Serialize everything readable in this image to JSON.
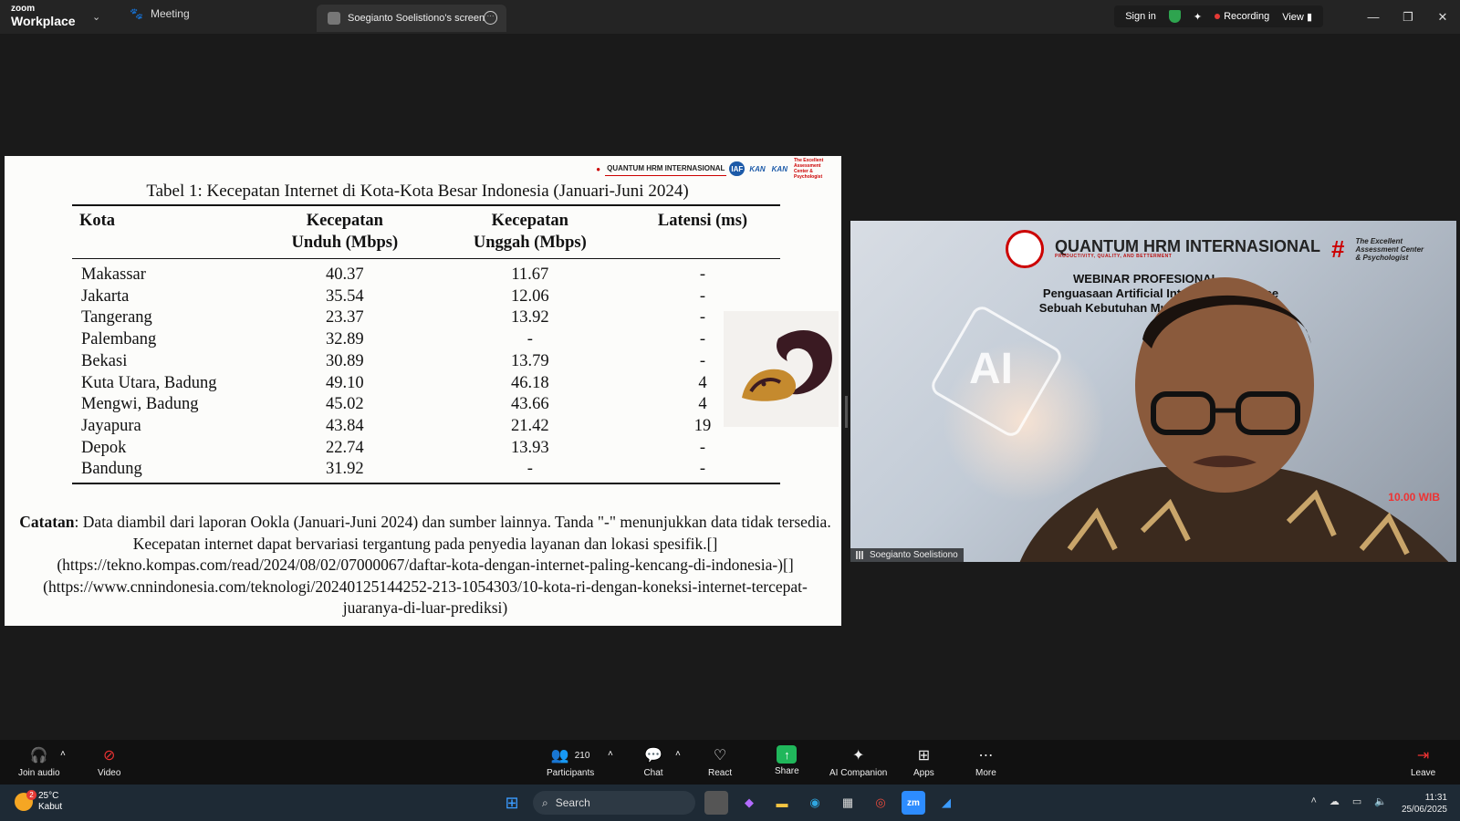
{
  "app": {
    "brand_top": "zoom",
    "brand_bottom": "Workplace"
  },
  "tabs": {
    "meeting": "Meeting",
    "screen": "Soegianto Soelistiono's screen"
  },
  "topright": {
    "sign_in": "Sign in",
    "recording": "Recording",
    "view": "View"
  },
  "shared": {
    "logos": [
      "QUANTUM HRM INTERNASIONAL",
      "IAF",
      "KAN",
      "KAN",
      "The Excellent Assessment Center & Psychologist"
    ],
    "caption": "Tabel 1: Kecepatan Internet di Kota-Kota Besar Indonesia (Januari-Juni 2024)",
    "headers": {
      "kota": "Kota",
      "unduh_1": "Kecepatan",
      "unduh_2": "Unduh (Mbps)",
      "unggah_1": "Kecepatan",
      "unggah_2": "Unggah (Mbps)",
      "latensi": "Latensi (ms)"
    },
    "rows": [
      {
        "kota": "Makassar",
        "unduh": "40.37",
        "unggah": "11.67",
        "latensi": "-"
      },
      {
        "kota": "Jakarta",
        "unduh": "35.54",
        "unggah": "12.06",
        "latensi": "-"
      },
      {
        "kota": "Tangerang",
        "unduh": "23.37",
        "unggah": "13.92",
        "latensi": "-"
      },
      {
        "kota": "Palembang",
        "unduh": "32.89",
        "unggah": "-",
        "latensi": "-"
      },
      {
        "kota": "Bekasi",
        "unduh": "30.89",
        "unggah": "13.79",
        "latensi": "-"
      },
      {
        "kota": "Kuta Utara, Badung",
        "unduh": "49.10",
        "unggah": "46.18",
        "latensi": "4"
      },
      {
        "kota": "Mengwi, Badung",
        "unduh": "45.02",
        "unggah": "43.66",
        "latensi": "4"
      },
      {
        "kota": "Jayapura",
        "unduh": "43.84",
        "unggah": "21.42",
        "latensi": "19"
      },
      {
        "kota": "Depok",
        "unduh": "22.74",
        "unggah": "13.93",
        "latensi": "-"
      },
      {
        "kota": "Bandung",
        "unduh": "31.92",
        "unggah": "-",
        "latensi": "-"
      }
    ],
    "note_label": "Catatan",
    "note_text": ": Data diambil dari laporan Ookla (Januari-Juni 2024) dan sumber lainnya. Tanda \"-\" menunjukkan data tidak tersedia. Kecepatan internet dapat bervariasi tergantung pada penyedia layanan dan lokasi spesifik.[](https://tekno.kompas.com/read/2024/08/02/07000067/daftar-kota-dengan-internet-paling-kencang-di-indonesia-)[](https://www.cnnindonesia.com/teknologi/20240125144252-213-1054303/10-kota-ri-dengan-koneksi-internet-tercepat-juaranya-di-luar-prediksi)"
  },
  "video": {
    "logo_main": "QUANTUM HRM INTERNASIONAL",
    "logo_tag": "PRODUCTIVITY, QUALITY, AND BETTERMENT",
    "logo_side": "The Excellent Assessment Center & Psychologist",
    "title": "WEBINAR PROFESIONAL",
    "subtitle_1": "Penguasaan Artificial Intellegence ... ence",
    "subtitle_2": "Sebuah Kebutuhan Mutlak Person... angsa.",
    "ai_text": "AI",
    "time_text": "10.00 WIB",
    "participant_name": "Soegianto Soelistiono"
  },
  "controls": {
    "join_audio": "Join audio",
    "video": "Video",
    "participants": "Participants",
    "participants_count": "210",
    "chat": "Chat",
    "react": "React",
    "share": "Share",
    "ai_companion": "AI Companion",
    "apps": "Apps",
    "more": "More",
    "leave": "Leave"
  },
  "taskbar": {
    "temp": "25°C",
    "weather": "Kabut",
    "weather_badge": "2",
    "search": "Search",
    "time": "11:31",
    "date": "25/06/2025"
  },
  "colors": {
    "accent_green": "#20b75b",
    "record_red": "#e53935",
    "panel_bg": "#1a1a1a"
  }
}
